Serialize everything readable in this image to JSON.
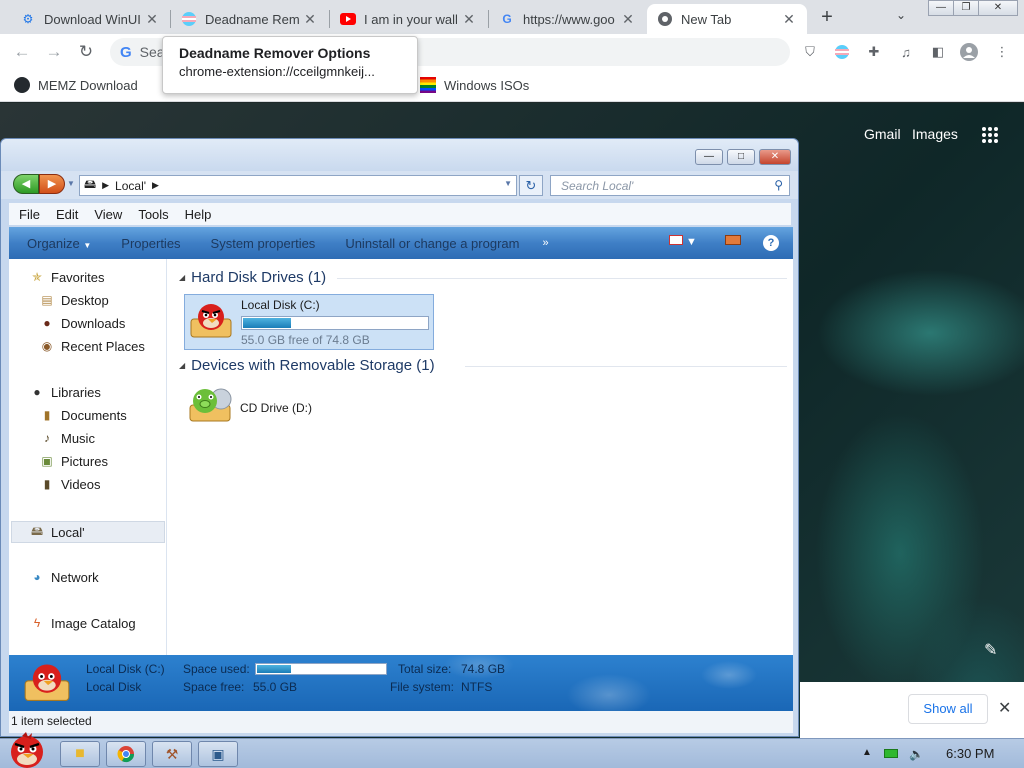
{
  "browser": {
    "tabs": [
      {
        "label": "Download WinUI",
        "favicon": "gear-icon",
        "color": "#1a73e8"
      },
      {
        "label": "Deadname Rem",
        "favicon": "trans-flag-icon",
        "color": "#5bcefa"
      },
      {
        "label": "I am in your wall",
        "favicon": "youtube-icon",
        "color": "#ff0000"
      },
      {
        "label": "https://www.goo",
        "favicon": "google-icon",
        "color": "#4285f4"
      },
      {
        "label": "New Tab",
        "favicon": "chrome-icon",
        "color": "#5f6368"
      }
    ],
    "new_tab": "+",
    "omnibox_text": "Sea",
    "bookmarks": [
      {
        "label": "MEMZ Download"
      },
      {
        "label": "Windows ISOs"
      }
    ],
    "tooltip": {
      "title": "Deadname Remover Options",
      "url": "chrome-extension://cceilgmnkeij..."
    },
    "ntp_links": {
      "gmail": "Gmail",
      "images": "Images"
    },
    "download_bar": {
      "show_all": "Show all"
    }
  },
  "explorer": {
    "address": "Local'",
    "search_placeholder": "Search Local'",
    "menu": [
      "File",
      "Edit",
      "View",
      "Tools",
      "Help"
    ],
    "commands": [
      "Organize",
      "Properties",
      "System properties",
      "Uninstall or change a program"
    ],
    "commands_more": "»",
    "help": "?",
    "nav": {
      "favorites": "Favorites",
      "favorites_items": [
        "Desktop",
        "Downloads",
        "Recent Places"
      ],
      "libraries": "Libraries",
      "libraries_items": [
        "Documents",
        "Music",
        "Pictures",
        "Videos"
      ],
      "computer": "Local'",
      "network": "Network",
      "image_catalog": "Image Catalog"
    },
    "groups": {
      "hdd": "Hard Disk Drives (1)",
      "removable": "Devices with Removable Storage (1)"
    },
    "drive_c": {
      "name": "Local Disk (C:)",
      "free_text": "55.0 GB free of 74.8 GB",
      "used_fraction": 0.26
    },
    "drive_d": {
      "name": "CD Drive (D:)"
    },
    "details": {
      "name": "Local Disk (C:)",
      "type": "Local Disk",
      "space_used_label": "Space used:",
      "space_free_label": "Space free:",
      "space_free": "55.0 GB",
      "total_size_label": "Total size:",
      "total_size": "74.8 GB",
      "fs_label": "File system:",
      "fs": "NTFS",
      "used_fraction": 0.26
    },
    "status": "1 item selected"
  },
  "taskbar": {
    "clock": "6:30 PM"
  }
}
